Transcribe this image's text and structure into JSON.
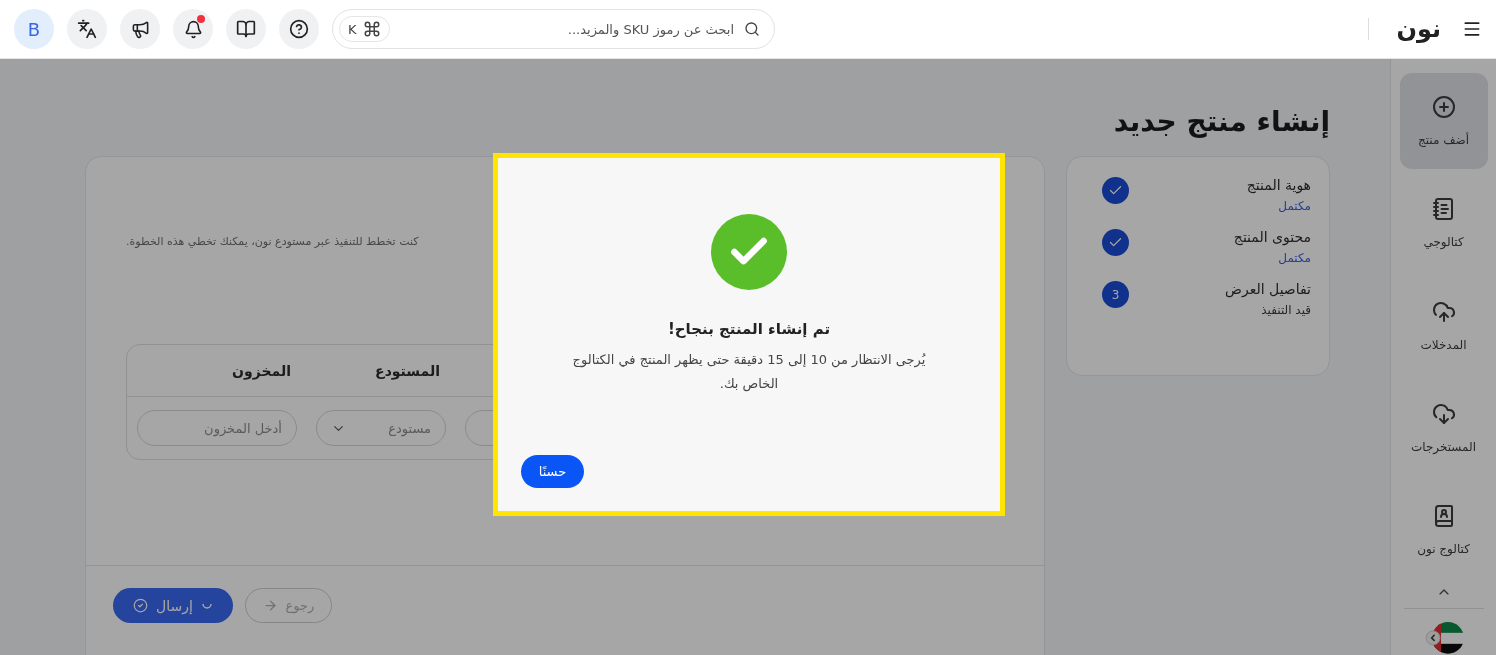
{
  "topbar": {
    "logo": "نون",
    "search": {
      "placeholder": "ابحث عن رموز SKU والمزيد...",
      "shortcut_key": "K"
    },
    "avatar": "B",
    "has_unread": true
  },
  "sidebar": {
    "items": [
      {
        "label": "أضف منتج",
        "selected": true
      },
      {
        "label": "كتالوجي",
        "selected": false
      },
      {
        "label": "المدخلات",
        "selected": false
      },
      {
        "label": "المستخرجات",
        "selected": false
      },
      {
        "label": "كتالوج نون",
        "selected": false
      }
    ]
  },
  "page_title": "إنشاء منتج جديد",
  "steps": [
    {
      "title": "هوية المنتج",
      "status": "مكتمل",
      "done": true
    },
    {
      "title": "محتوى المنتج",
      "status": "مكتمل",
      "done": true
    },
    {
      "title": "تفاصيل العرض",
      "status": "قيد التنفيذ",
      "done": false,
      "number": "3"
    }
  ],
  "offer_card": {
    "notice": "كنت تخطط للتنفيذ عبر مستودع نون، يمكنك تخطي هذه الخطوة.",
    "table": {
      "columns": [
        "المستودع",
        "المخزون"
      ],
      "fields": [
        {
          "kind": "input"
        },
        {
          "kind": "select",
          "placeholder": "مستودع"
        },
        {
          "kind": "input",
          "placeholder": "أدخل المخزون"
        }
      ]
    },
    "submit_button": {
      "label": "إرسال"
    },
    "back_button": {
      "label": "رجوع",
      "disabled": true
    }
  },
  "modal": {
    "title": "تم إنشاء المنتج بنجاح!",
    "message": "يُرجى الانتظار من 10 إلى 15 دقيقة حتى يظهر المنتج في الكتالوج الخاص بك.",
    "button": "حسنًا"
  }
}
